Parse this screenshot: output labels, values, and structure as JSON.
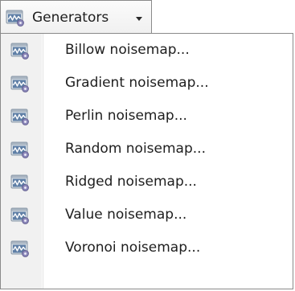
{
  "menu": {
    "label": "Generators",
    "icon": "noisemap-icon",
    "caret_icon": "dropdown-caret-icon",
    "items": [
      {
        "label": "Billow noisemap...",
        "icon": "noisemap-icon"
      },
      {
        "label": "Gradient noisemap...",
        "icon": "noisemap-icon"
      },
      {
        "label": "Perlin noisemap...",
        "icon": "noisemap-icon"
      },
      {
        "label": "Random noisemap...",
        "icon": "noisemap-icon"
      },
      {
        "label": "Ridged noisemap...",
        "icon": "noisemap-icon"
      },
      {
        "label": "Value noisemap...",
        "icon": "noisemap-icon"
      },
      {
        "label": "Voronoi noisemap...",
        "icon": "noisemap-icon"
      }
    ]
  },
  "colors": {
    "icon_frame": "#9aa7b3",
    "icon_screen": "#6e86a4",
    "icon_wave": "#ffffff",
    "icon_gear": "#7a7aa8"
  }
}
